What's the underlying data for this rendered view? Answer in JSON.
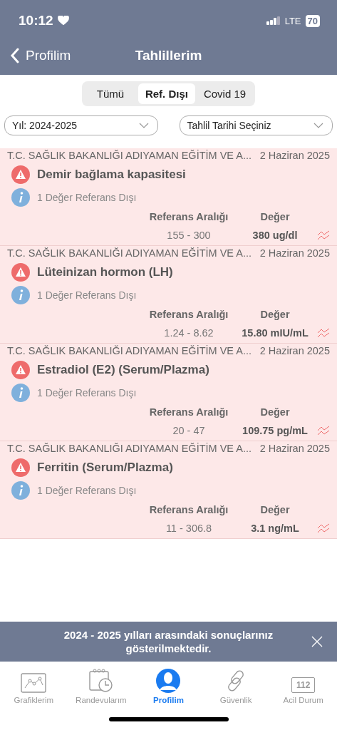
{
  "status_bar": {
    "time": "10:12",
    "network": "LTE",
    "battery": "70"
  },
  "nav": {
    "back": "Profilim",
    "title": "Tahlillerim"
  },
  "tabs": [
    {
      "label": "Tümü",
      "selected": false
    },
    {
      "label": "Ref. Dışı",
      "selected": true
    },
    {
      "label": "Covid 19",
      "selected": false
    }
  ],
  "filters": [
    {
      "value": "Yıl: 2024-2025"
    },
    {
      "value": "Tahlil Tarihi Seçiniz"
    }
  ],
  "results": [
    {
      "institution": "T.C. SAĞLIK BAKANLIĞI ADIYAMAN EĞİTİM VE A...",
      "date": "2 Haziran 2025",
      "test": "Demir bağlama kapasitesi",
      "note": "1 Değer Referans Dışı",
      "range_label": "Referans Aralığı",
      "value_label": "Değer",
      "range": "155 - 300",
      "value": "380 ug/dl"
    },
    {
      "institution": "T.C. SAĞLIK BAKANLIĞI ADIYAMAN EĞİTİM VE A...",
      "date": "2 Haziran 2025",
      "test": "Lüteinizan hormon (LH)",
      "note": "1 Değer Referans Dışı",
      "range_label": "Referans Aralığı",
      "value_label": "Değer",
      "range": "1.24 - 8.62",
      "value": "15.80 mIU/mL"
    },
    {
      "institution": "T.C. SAĞLIK BAKANLIĞI ADIYAMAN EĞİTİM VE A...",
      "date": "2 Haziran 2025",
      "test": "Estradiol (E2) (Serum/Plazma)",
      "note": "1 Değer Referans Dışı",
      "range_label": "Referans Aralığı",
      "value_label": "Değer",
      "range": "20 - 47",
      "value": "109.75 pg/mL"
    },
    {
      "institution": "T.C. SAĞLIK BAKANLIĞI ADIYAMAN EĞİTİM VE A...",
      "date": "2 Haziran 2025",
      "test": "Ferritin (Serum/Plazma)",
      "note": "1 Değer Referans Dışı",
      "range_label": "Referans Aralığı",
      "value_label": "Değer",
      "range": "11 - 306.8",
      "value": "3.1 ng/mL"
    }
  ],
  "banner": {
    "message": "2024 - 2025 yılları arasındaki sonuçlarınız gösterilmektedir."
  },
  "tab_bar": [
    {
      "kind": "chart",
      "label": "Grafiklerim",
      "selected": false
    },
    {
      "kind": "calendar",
      "label": "Randevularım",
      "selected": false
    },
    {
      "kind": "profile",
      "label": "Profilim",
      "selected": true
    },
    {
      "kind": "link",
      "label": "Güvenlik",
      "selected": false
    },
    {
      "kind": "emergency",
      "label": "Acil Durum",
      "selected": false,
      "icon_text": "112"
    }
  ]
}
